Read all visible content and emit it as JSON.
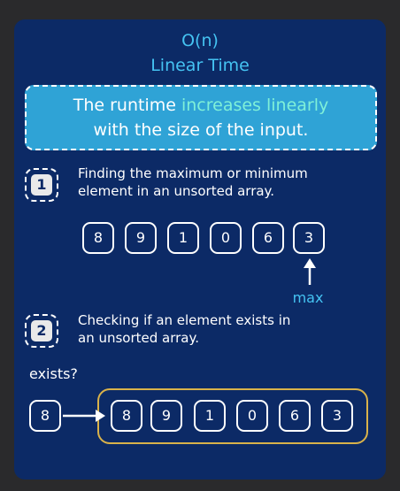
{
  "header": {
    "title": "O(n)",
    "subtitle": "Linear Time"
  },
  "highlight": {
    "line1_pre": "The runtime ",
    "line1_accent": "increases linearly",
    "line2": "with the size of the input."
  },
  "example1": {
    "number": "1",
    "text_line1": "Finding the maximum or minimum",
    "text_line2": "element in an unsorted array.",
    "array": [
      "8",
      "9",
      "1",
      "0",
      "6",
      "3"
    ],
    "max_label": "max"
  },
  "example2": {
    "number": "2",
    "text_line1": "Checking if an element exists in",
    "text_line2": "an unsorted array.",
    "query_label": "exists?",
    "query_value": "8",
    "array": [
      "8",
      "9",
      "1",
      "0",
      "6",
      "3"
    ]
  },
  "colors": {
    "background": "#0c2a66",
    "accent": "#45c3f2",
    "highlight_box": "#2fa3d6",
    "highlight_text": "#7ff0d8",
    "search_box_border": "#d9b24a"
  }
}
